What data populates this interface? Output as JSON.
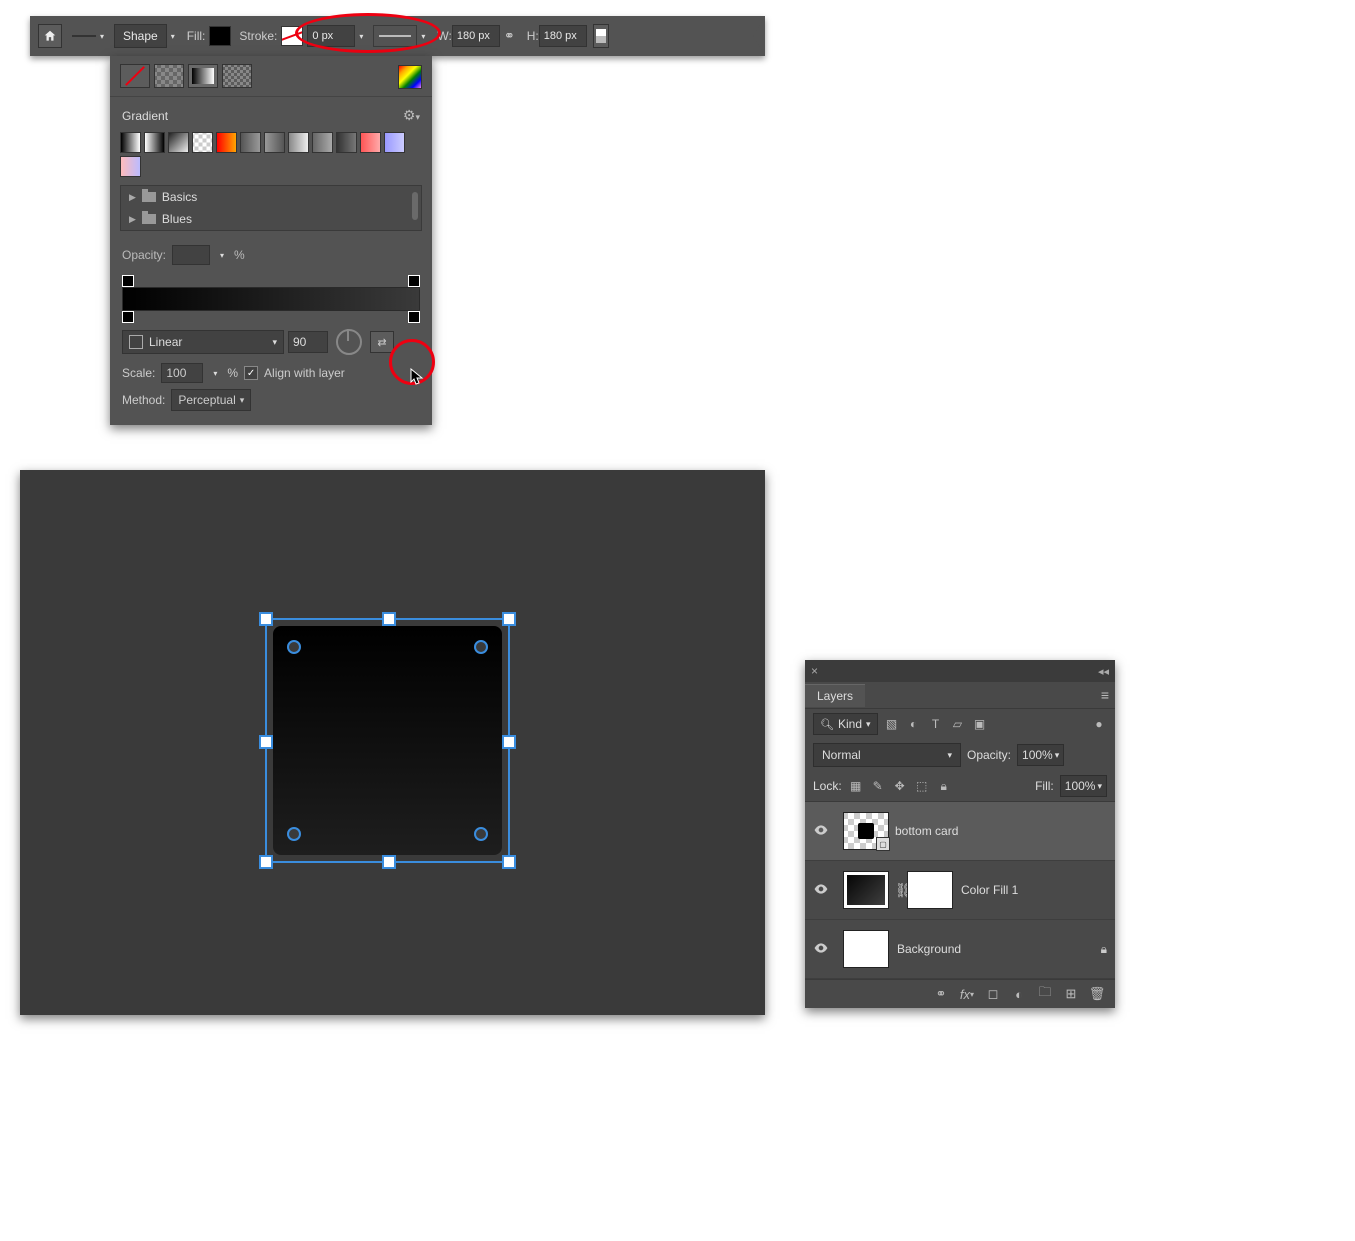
{
  "optionsBar": {
    "toolModeLabel": "Shape",
    "fillLabel": "Fill:",
    "strokeLabel": "Stroke:",
    "strokeWidth": "0 px",
    "widthLabel": "W:",
    "widthValue": "180 px",
    "heightLabel": "H:",
    "heightValue": "180 px"
  },
  "gradientPanel": {
    "title": "Gradient",
    "folders": {
      "basics": "Basics",
      "blues": "Blues"
    },
    "opacityLabel": "Opacity:",
    "opacityUnit": "%",
    "typeLabel": "Linear",
    "angle": "90",
    "scaleLabel": "Scale:",
    "scaleValue": "100",
    "scaleUnit": "%",
    "alignLabel": "Align with layer",
    "methodLabel": "Method:",
    "methodValue": "Perceptual"
  },
  "layersPanel": {
    "tabLabel": "Layers",
    "kindLabel": "Kind",
    "blendMode": "Normal",
    "opacityLabel": "Opacity:",
    "opacityValue": "100%",
    "lockLabel": "Lock:",
    "fillLabel": "Fill:",
    "fillValue": "100%",
    "layers": {
      "bottomCard": "bottom card",
      "colorFill": "Color Fill 1",
      "background": "Background"
    }
  },
  "presetGradients": [
    "linear-gradient(90deg,#000,#fff)",
    "linear-gradient(90deg,#fff,#000)",
    "linear-gradient(135deg,#222,#eee)",
    "repeating-conic-gradient(#ccc 0 25%,#fff 0 50%) 50%/8px 8px",
    "linear-gradient(90deg,red,orange)",
    "linear-gradient(90deg,#555,#999)",
    "linear-gradient(90deg,#999,#555)",
    "linear-gradient(90deg,#888,#eee)",
    "linear-gradient(90deg,#666,#aaa)",
    "linear-gradient(90deg,#333,#777)",
    "linear-gradient(90deg,#f55,#faa)",
    "linear-gradient(90deg,#99f,#ccf)",
    "linear-gradient(90deg,#fbb,#bbf)"
  ]
}
